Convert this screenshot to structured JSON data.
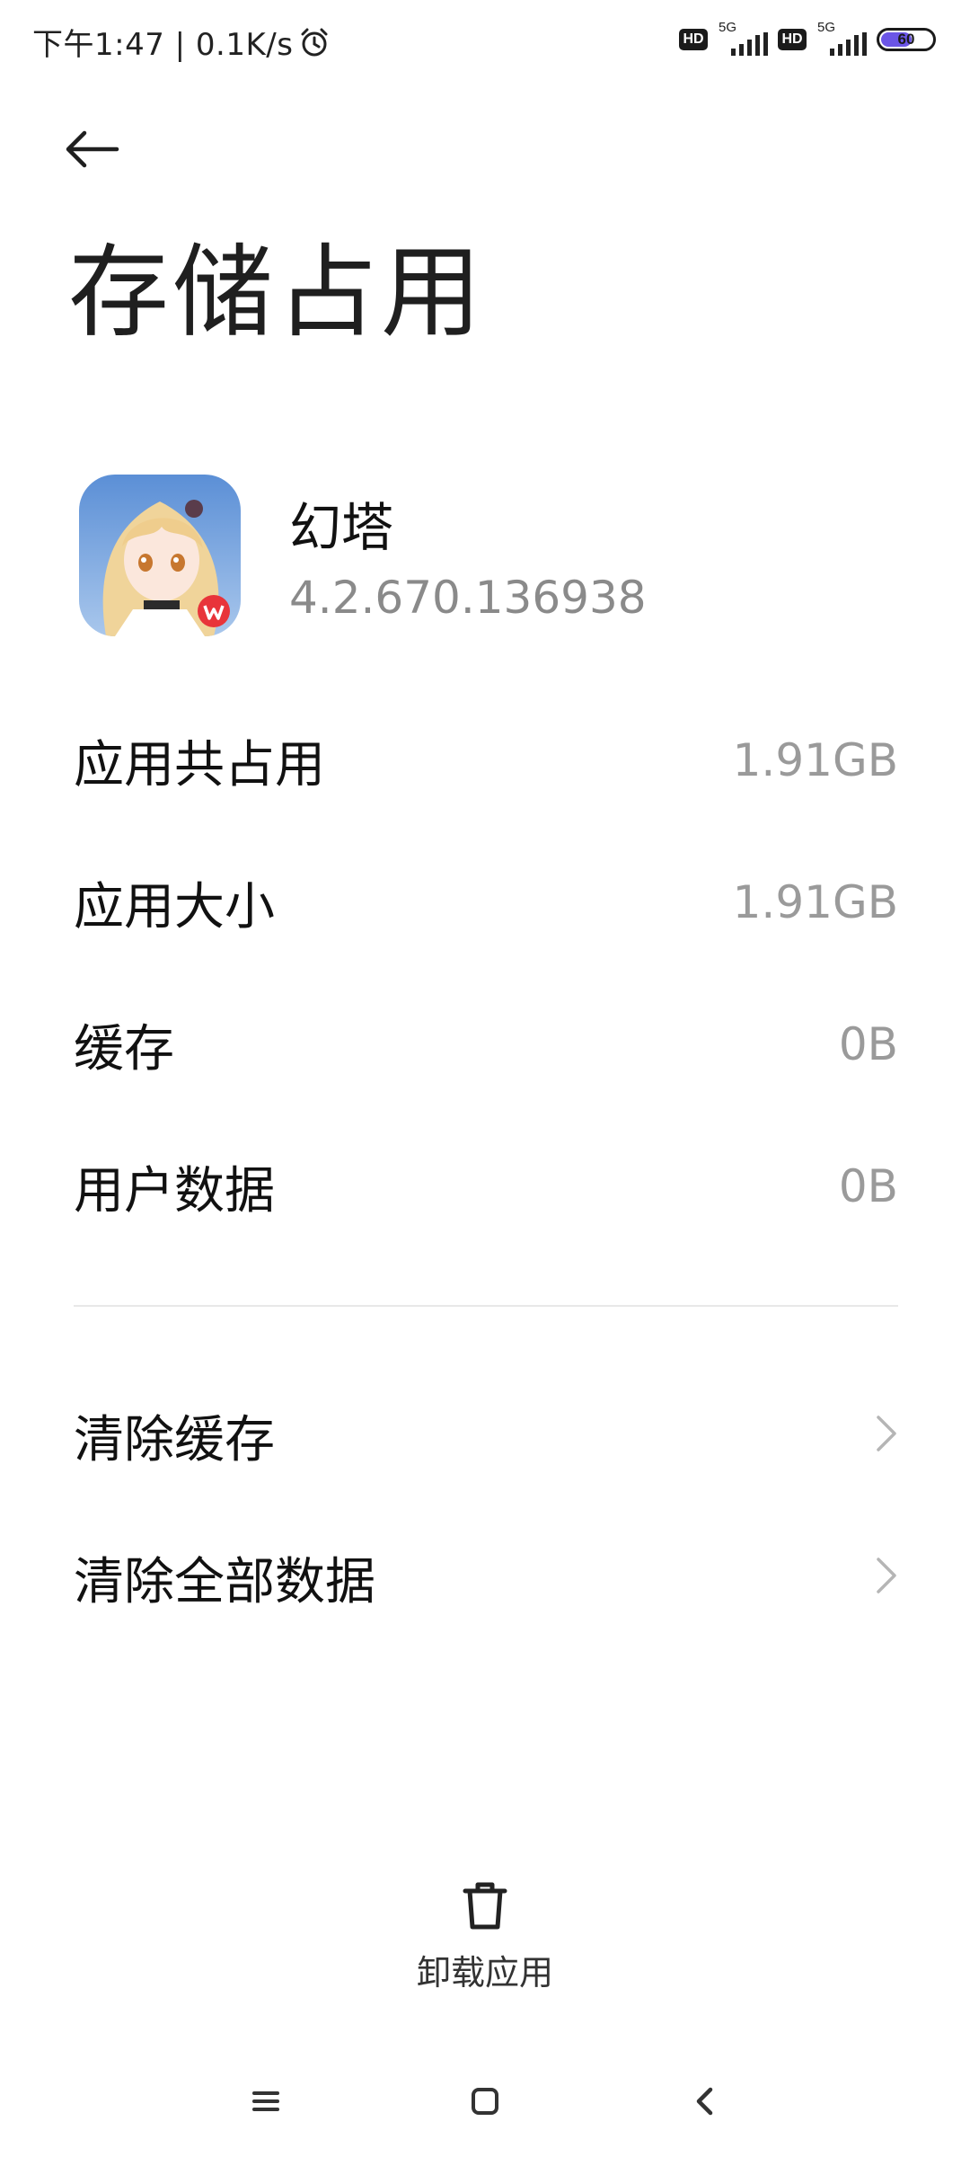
{
  "status_bar": {
    "time_speed": "下午1:47 | 0.1K/s",
    "hd_label": "HD",
    "network_type": "5G",
    "battery_level": "60",
    "battery_color": "#6b55e6"
  },
  "header": {
    "back_icon": "arrow-left-icon",
    "title": "存储占用"
  },
  "app": {
    "name": "幻塔",
    "version": "4.2.670.136938"
  },
  "storage": {
    "rows": [
      {
        "label": "应用共占用",
        "value": "1.91GB"
      },
      {
        "label": "应用大小",
        "value": "1.91GB"
      },
      {
        "label": "缓存",
        "value": "0B"
      },
      {
        "label": "用户数据",
        "value": "0B"
      }
    ]
  },
  "actions": [
    {
      "label": "清除缓存",
      "icon": "chevron-right-icon"
    },
    {
      "label": "清除全部数据",
      "icon": "chevron-right-icon"
    }
  ],
  "bottom": {
    "uninstall_label": "卸载应用",
    "uninstall_icon": "trash-icon"
  },
  "nav": {
    "menu_icon": "menu-icon",
    "home_icon": "home-icon",
    "back_icon": "back-icon"
  }
}
